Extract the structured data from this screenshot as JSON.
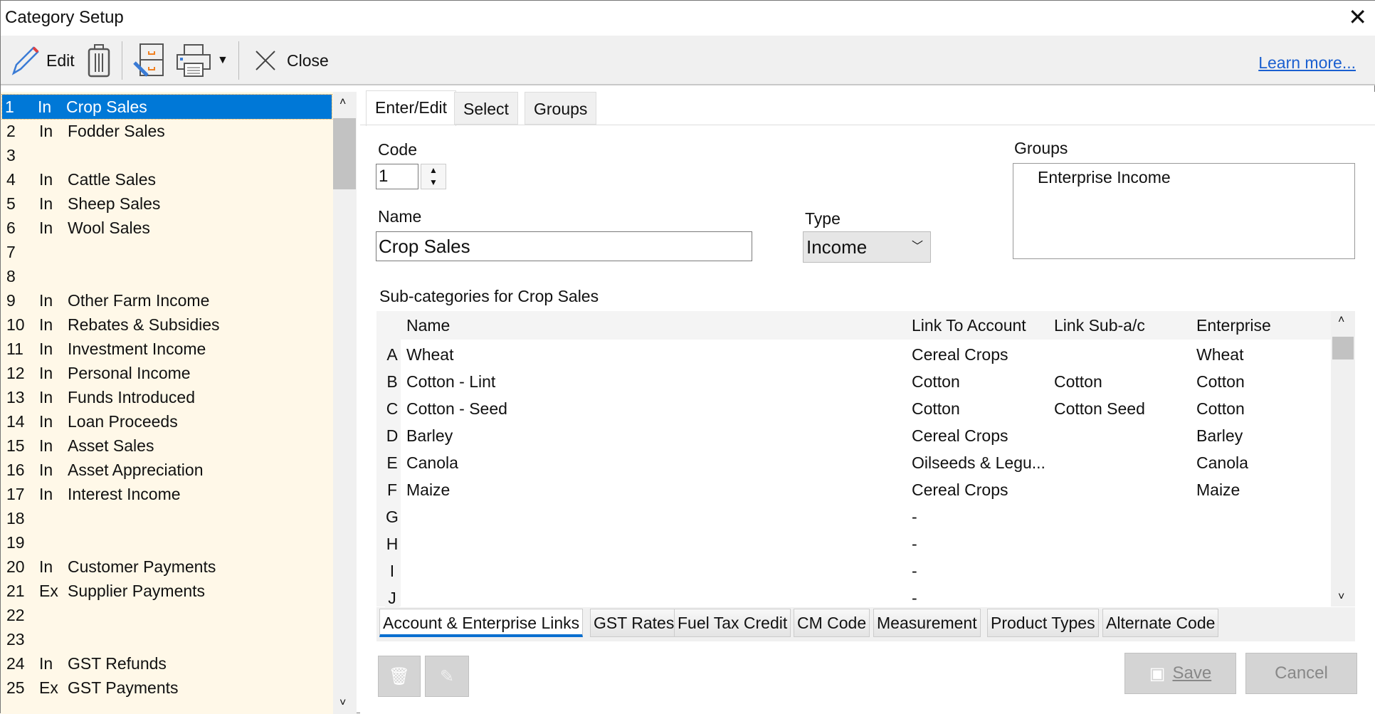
{
  "window": {
    "title": "Category Setup",
    "close_icon": "close-icon"
  },
  "toolbar": {
    "edit": "Edit",
    "close": "Close",
    "learn_more": "Learn more..."
  },
  "categories": [
    {
      "code": "1",
      "type": "In",
      "name": "Crop Sales",
      "selected": true
    },
    {
      "code": "2",
      "type": "In",
      "name": "Fodder Sales"
    },
    {
      "code": "3",
      "type": "",
      "name": ""
    },
    {
      "code": "4",
      "type": "In",
      "name": "Cattle Sales"
    },
    {
      "code": "5",
      "type": "In",
      "name": "Sheep Sales"
    },
    {
      "code": "6",
      "type": "In",
      "name": "Wool Sales"
    },
    {
      "code": "7",
      "type": "",
      "name": ""
    },
    {
      "code": "8",
      "type": "",
      "name": ""
    },
    {
      "code": "9",
      "type": "In",
      "name": "Other Farm Income"
    },
    {
      "code": "10",
      "type": "In",
      "name": "Rebates & Subsidies"
    },
    {
      "code": "11",
      "type": "In",
      "name": "Investment Income"
    },
    {
      "code": "12",
      "type": "In",
      "name": "Personal Income"
    },
    {
      "code": "13",
      "type": "In",
      "name": "Funds Introduced"
    },
    {
      "code": "14",
      "type": "In",
      "name": "Loan Proceeds"
    },
    {
      "code": "15",
      "type": "In",
      "name": "Asset Sales"
    },
    {
      "code": "16",
      "type": "In",
      "name": "Asset Appreciation"
    },
    {
      "code": "17",
      "type": "In",
      "name": "Interest Income"
    },
    {
      "code": "18",
      "type": "",
      "name": ""
    },
    {
      "code": "19",
      "type": "",
      "name": ""
    },
    {
      "code": "20",
      "type": "In",
      "name": "Customer Payments"
    },
    {
      "code": "21",
      "type": "Ex",
      "name": "Supplier Payments"
    },
    {
      "code": "22",
      "type": "",
      "name": ""
    },
    {
      "code": "23",
      "type": "",
      "name": ""
    },
    {
      "code": "24",
      "type": "In",
      "name": "GST Refunds"
    },
    {
      "code": "25",
      "type": "Ex",
      "name": "GST Payments"
    }
  ],
  "tabs": [
    "Enter/Edit",
    "Select",
    "Groups"
  ],
  "form": {
    "code_label": "Code",
    "code_value": "1",
    "name_label": "Name",
    "name_value": "Crop Sales",
    "type_label": "Type",
    "type_value": "Income",
    "groups_label": "Groups",
    "groups": [
      "Enterprise Income"
    ],
    "sub_label": "Sub-categories for Crop Sales"
  },
  "grid": {
    "headers": [
      "Name",
      "Link To Account",
      "Link Sub-a/c",
      "Enterprise"
    ],
    "rows": [
      [
        "A",
        "Wheat",
        "Cereal Crops",
        "",
        "Wheat"
      ],
      [
        "B",
        "Cotton - Lint",
        "Cotton",
        "Cotton",
        "Cotton"
      ],
      [
        "C",
        "Cotton - Seed",
        "Cotton",
        "Cotton Seed",
        "Cotton"
      ],
      [
        "D",
        "Barley",
        "Cereal Crops",
        "",
        "Barley"
      ],
      [
        "E",
        "Canola",
        "Oilseeds & Legu...",
        "",
        "Canola"
      ],
      [
        "F",
        "Maize",
        "Cereal Crops",
        "",
        "Maize"
      ],
      [
        "G",
        "",
        "-",
        "",
        ""
      ],
      [
        "H",
        "",
        "-",
        "",
        ""
      ],
      [
        "I",
        "",
        "-",
        "",
        ""
      ],
      [
        "J",
        "",
        "-",
        "",
        ""
      ]
    ]
  },
  "bottom_tabs": [
    "Account & Enterprise Links",
    "GST Rates",
    "Fuel Tax Credit",
    "CM Code",
    "Measurement",
    "Product Types",
    "Alternate Code"
  ],
  "buttons": {
    "save": "Save",
    "cancel": "Cancel"
  },
  "colors": {
    "selection": "#0078d7",
    "list_bg": "#fff8e8",
    "link": "#1a5fd0"
  }
}
